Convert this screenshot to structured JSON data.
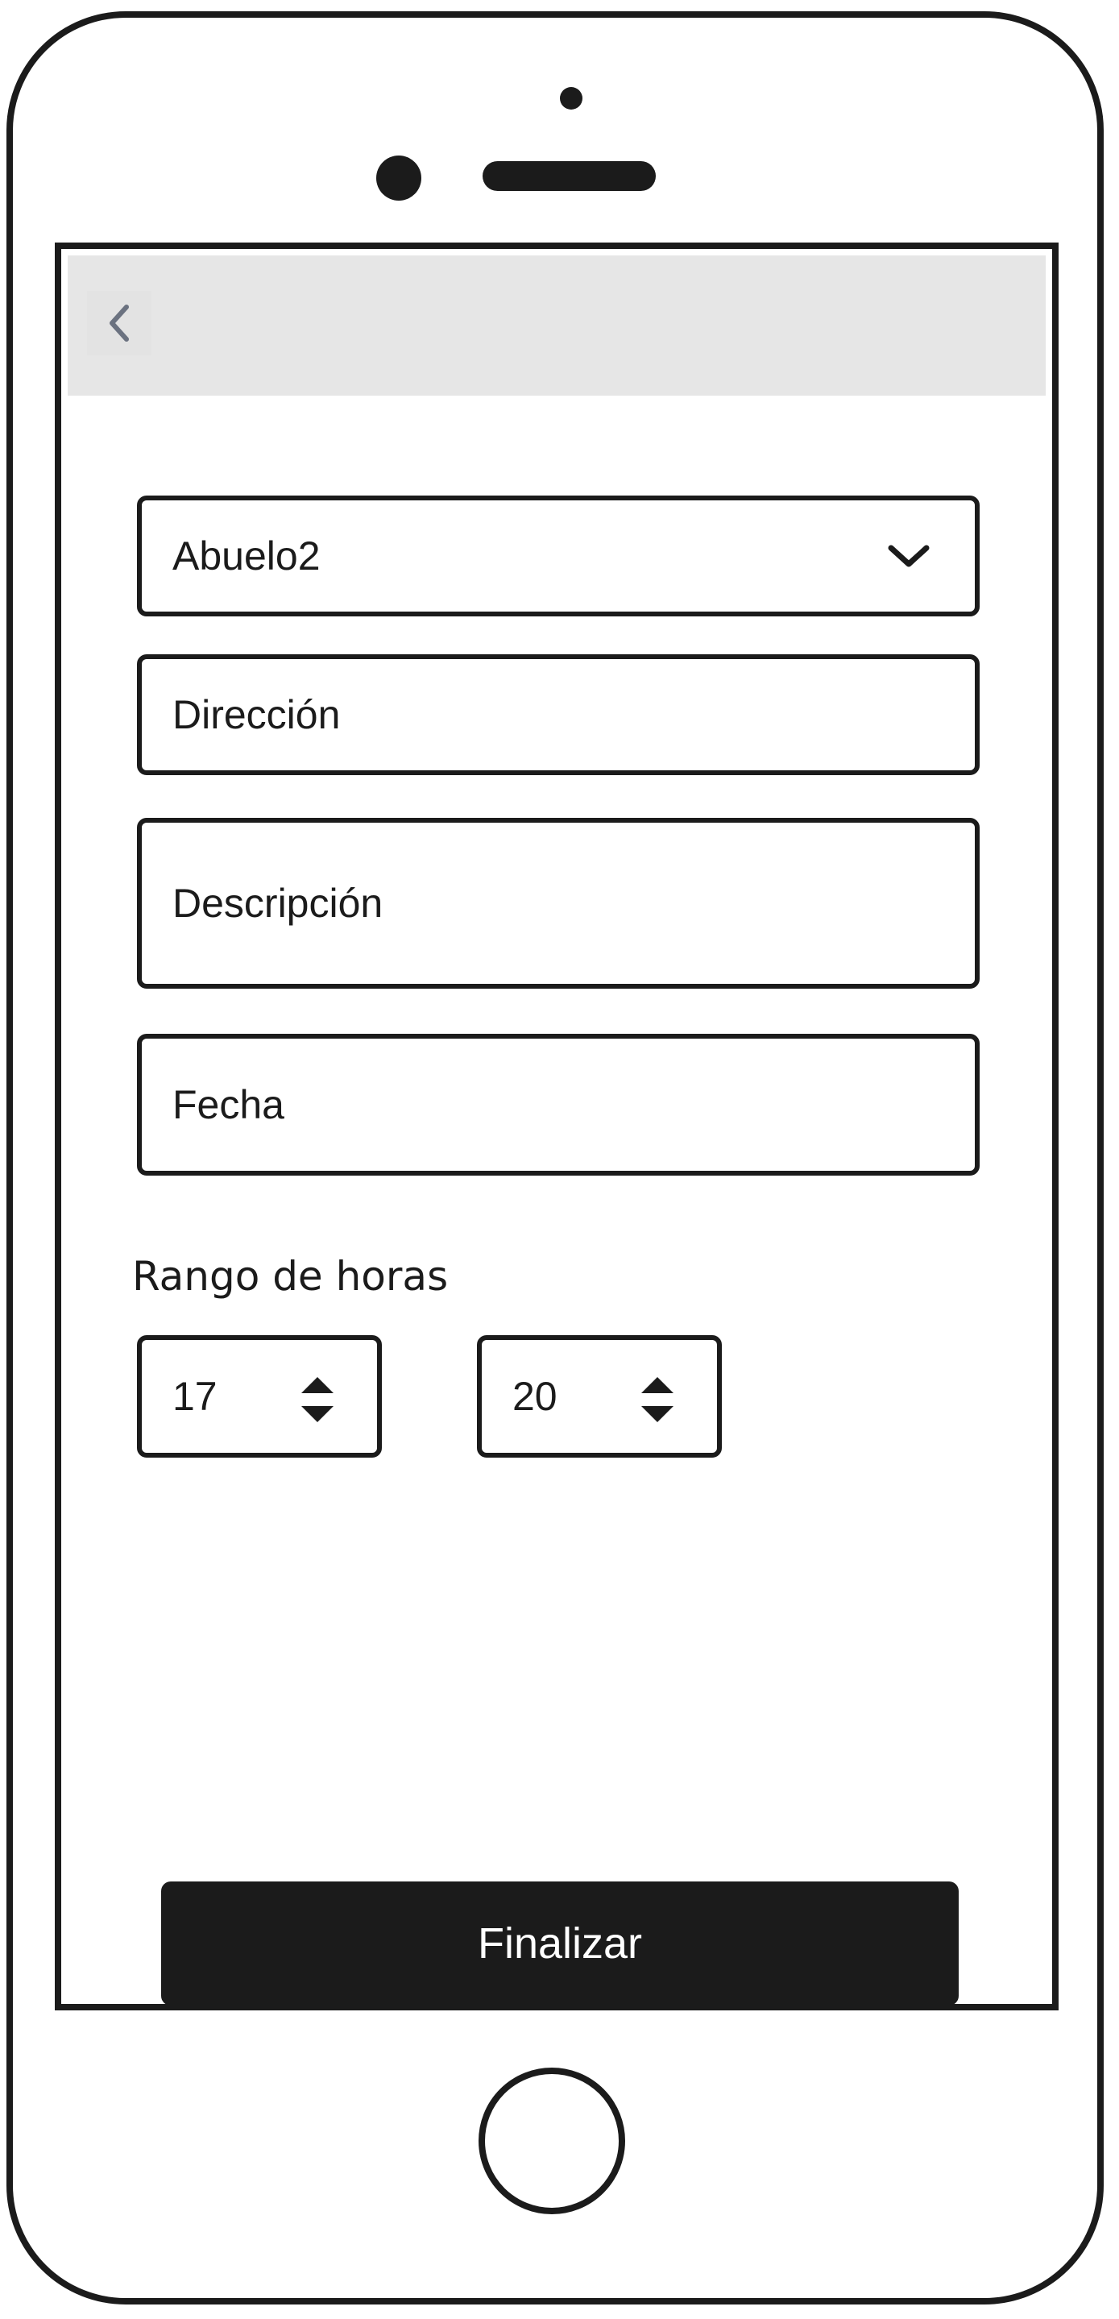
{
  "header": {
    "back_icon": "chevron-left-icon"
  },
  "form": {
    "person_select": {
      "value": "Abuelo2",
      "icon": "chevron-down-icon"
    },
    "address": {
      "placeholder": "Dirección"
    },
    "description": {
      "placeholder": "Descripción"
    },
    "date": {
      "placeholder": "Fecha"
    },
    "hour_range": {
      "label": "Rango de horas",
      "from": "17",
      "to": "20",
      "stepper_icon": "up-down-arrows-icon"
    }
  },
  "actions": {
    "finish_label": "Finalizar"
  },
  "colors": {
    "ink": "#1b1b1b",
    "header_bg": "#e6e6e6",
    "back_icon": "#6b7280",
    "surface": "#ffffff"
  }
}
